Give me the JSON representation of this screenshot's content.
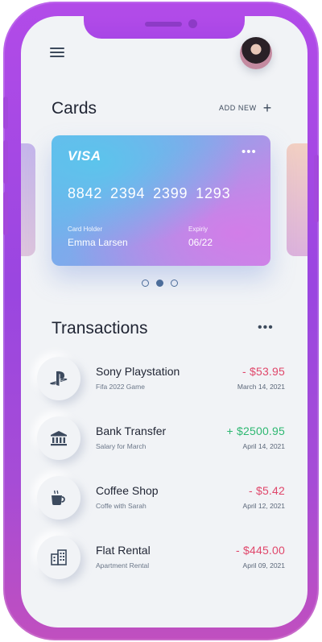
{
  "header": {
    "menu_icon": "hamburger-menu-icon",
    "avatar": "user-avatar"
  },
  "cards": {
    "title": "Cards",
    "add_new_label": "ADD NEW",
    "add_icon": "+",
    "card": {
      "brand": "VISA",
      "more": "•••",
      "number": "8842 2394 2399 1293",
      "holder_label": "Card Holder",
      "holder_name": "Emma Larsen",
      "expiry_label": "Expiriy",
      "expiry_date": "06/22"
    },
    "pager": {
      "count": 3,
      "active_index": 1
    }
  },
  "transactions": {
    "title": "Transactions",
    "more": "•••",
    "items": [
      {
        "icon": "playstation-icon",
        "name": "Sony Playstation",
        "subtitle": "Fifa 2022 Game",
        "amount": "- $53.95",
        "type": "debit",
        "date": "March 14, 2021"
      },
      {
        "icon": "bank-icon",
        "name": "Bank Transfer",
        "subtitle": "Salary for March",
        "amount": "+ $2500.95",
        "type": "credit",
        "date": "April 14, 2021"
      },
      {
        "icon": "coffee-cup-icon",
        "name": "Coffee Shop",
        "subtitle": "Coffe with Sarah",
        "amount": "- $5.42",
        "type": "debit",
        "date": "April 12, 2021"
      },
      {
        "icon": "building-icon",
        "name": "Flat Rental",
        "subtitle": "Apartment Rental",
        "amount": "- $445.00",
        "type": "debit",
        "date": "April 09, 2021"
      }
    ]
  },
  "colors": {
    "frame": "#a646e0",
    "debit": "#e0476b",
    "credit": "#2eb872",
    "text": "#1f2433"
  }
}
